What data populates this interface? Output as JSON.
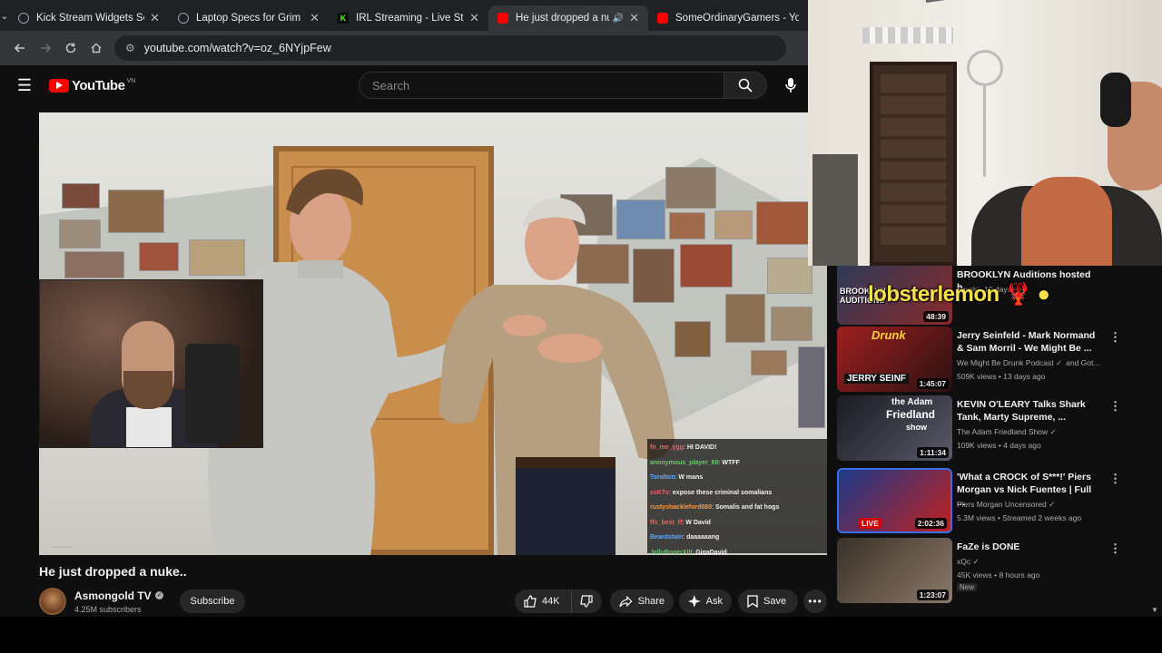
{
  "browser": {
    "tabs": [
      {
        "title": "Kick Stream Widgets Setup",
        "favicon_color": "#9aa0a6",
        "active": false
      },
      {
        "title": "Laptop Specs for Grim Dav",
        "favicon_color": "#9aa0a6",
        "active": false
      },
      {
        "title": "IRL Streaming - Live Strean",
        "favicon_color": "#53fc18",
        "active": false
      },
      {
        "title": "He just dropped a nuk",
        "favicon_color": "#ff0000",
        "active": true
      },
      {
        "title": "SomeOrdinaryGamers - Yo",
        "favicon_color": "#ff0000",
        "active": false
      }
    ],
    "url": "youtube.com/watch?v=oz_6NYjpFew"
  },
  "youtube": {
    "logo_text": "YouTube",
    "country_code": "VN",
    "search_placeholder": "Search"
  },
  "video": {
    "title": "He just dropped a nuke..",
    "channel": "Asmongold TV",
    "subscribers": "4.25M subscribers",
    "subscribe_label": "Subscribe",
    "likes": "44K",
    "share_label": "Share",
    "ask_label": "Ask",
    "save_label": "Save"
  },
  "chat": [
    {
      "user": "fn_me_ygg",
      "msg": "HI DAVID!",
      "color": "#ff5a5a"
    },
    {
      "user": "anonymous_player_69",
      "msg": "WTFF",
      "color": "#6ec56e"
    },
    {
      "user": "Toralton",
      "msg": "W mans",
      "color": "#5fa8ff"
    },
    {
      "user": "ssKTv",
      "msg": "expose these criminal somalians",
      "color": "#ff5a5a"
    },
    {
      "user": "rustyshackleford880",
      "msg": "Somalis and fat hogs",
      "color": "#ff9a3c"
    },
    {
      "user": "ffx_best_ff",
      "msg": "W David",
      "color": "#ff5a5a"
    },
    {
      "user": "Beardstain",
      "msg": "daaaaaang",
      "color": "#5fa8ff"
    },
    {
      "user": "JellyRogerXIII",
      "msg": "GigaDavid",
      "color": "#6ec56e"
    }
  ],
  "overlay": {
    "lobster_text": "lobsterlemon"
  },
  "recommendations": [
    {
      "title": "BROOKLYN Auditions hosted b...",
      "channel": "Druski",
      "meta": "10 days ago",
      "duration": "48:39",
      "live": false,
      "is_new": false
    },
    {
      "title": "Jerry Seinfeld - Mark Normand & Sam Morril - We Might Be ...",
      "channel": "We Might Be Drunk Podcast",
      "channel_extra": "and Got...",
      "meta": "509K views • 13 days ago",
      "duration": "1:45:07",
      "live": false,
      "is_new": false
    },
    {
      "title": "KEVIN O'LEARY Talks Shark Tank, Marty Supreme, ...",
      "channel": "The Adam Friedland Show",
      "meta": "109K views • 4 days ago",
      "duration": "1:11:34",
      "live": false,
      "is_new": false
    },
    {
      "title": "'What a CROCK of S***!' Piers Morgan vs Nick Fuentes | Full ...",
      "channel": "Piers Morgan Uncensored",
      "meta": "5.3M views • Streamed 2 weeks ago",
      "duration": "2:02:36",
      "live_label": "LIVE",
      "live": true,
      "is_new": false
    },
    {
      "title": "FaZe is DONE",
      "channel": "xQc",
      "meta": "45K views • 8 hours ago",
      "duration": "1:23:07",
      "live": false,
      "is_new": true,
      "new_label": "New"
    }
  ],
  "thumb_labels": {
    "rec0": "BROOKLYN AUDITIONS",
    "rec1_top": "Drunk",
    "rec1_bottom": "JERRY SEINF",
    "rec2_top": "the Adam",
    "rec2_mid": "Friedland",
    "rec2_bot": "show"
  }
}
